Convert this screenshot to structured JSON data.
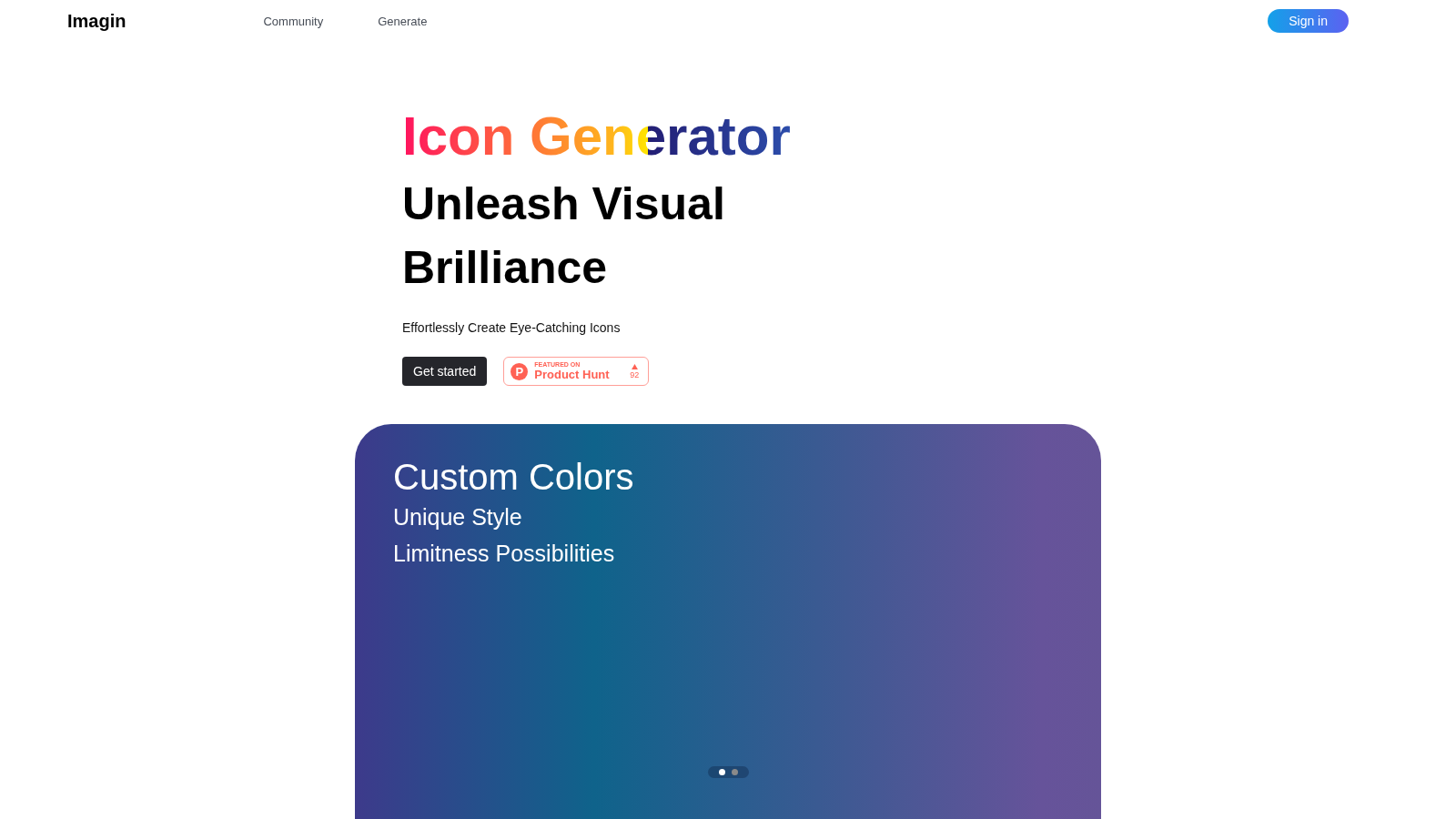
{
  "nav": {
    "logo": "Imagin",
    "links": [
      "Community",
      "Generate"
    ],
    "sign_in": "Sign in"
  },
  "hero": {
    "title": "Icon Generator",
    "headline": "Unleash Visual Brilliance",
    "subtitle": "Effortlessly Create Eye-Catching Icons",
    "cta": "Get started",
    "badge": {
      "logo": "P",
      "eyebrow": "FEATURED ON",
      "name": "Product Hunt",
      "count": "92"
    }
  },
  "slide": {
    "title": "Custom Colors",
    "lines": [
      "Unique Style",
      "Limitness Possibilities"
    ],
    "dots": [
      {
        "selected": true
      },
      {
        "selected": false
      }
    ]
  }
}
